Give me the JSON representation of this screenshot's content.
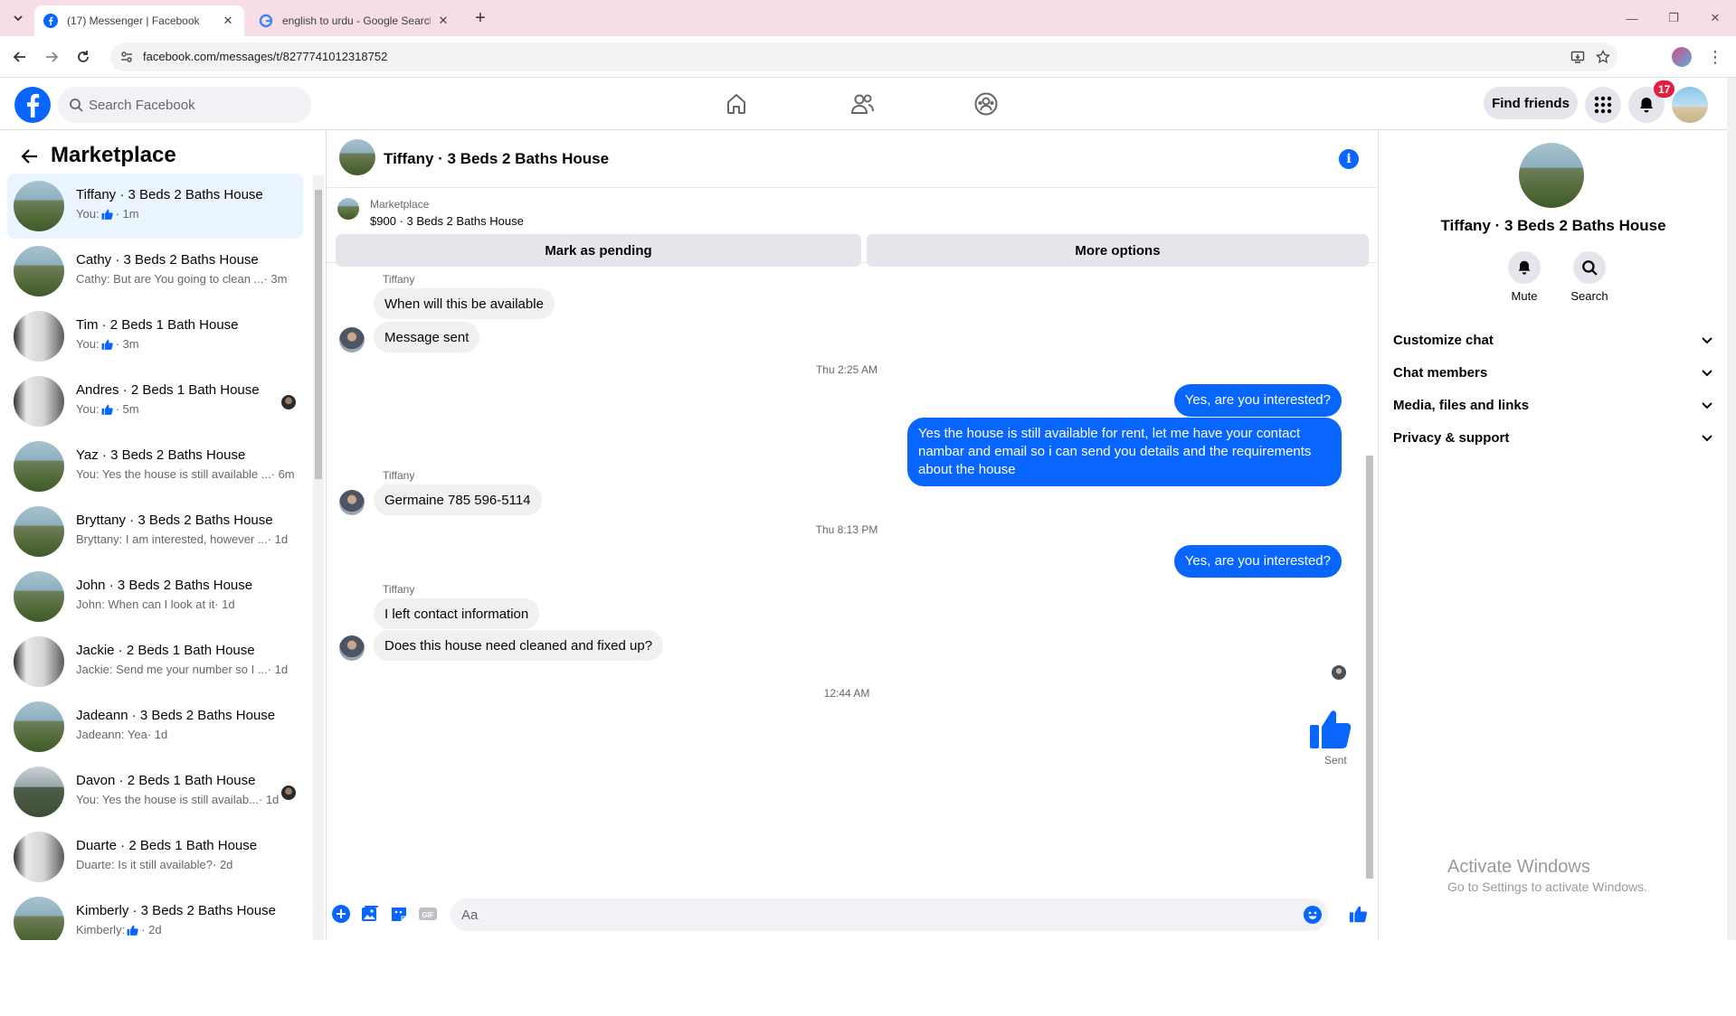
{
  "browser": {
    "tabs": [
      {
        "title": "(17) Messenger | Facebook",
        "active": true
      },
      {
        "title": "english to urdu - Google Search",
        "active": false
      }
    ],
    "url": "facebook.com/messages/t/8277741012318752"
  },
  "header": {
    "search_placeholder": "Search Facebook",
    "find_friends_label": "Find friends",
    "notification_count": "17"
  },
  "sidebar": {
    "title": "Marketplace",
    "conversations": [
      {
        "name": "Tiffany · 3 Beds 2 Baths House",
        "preview": "You:",
        "preview_like": true,
        "time": "· 1m",
        "active": true
      },
      {
        "name": "Cathy · 3 Beds 2 Baths House",
        "preview": "Cathy: But are You going to clean ... ",
        "preview_like": false,
        "time": "· 3m"
      },
      {
        "name": "Tim · 2 Beds 1 Bath House",
        "preview": "You:",
        "preview_like": true,
        "time": "· 3m"
      },
      {
        "name": "Andres · 2 Beds 1 Bath House",
        "preview": "You:",
        "preview_like": true,
        "time": "· 5m",
        "seen": true
      },
      {
        "name": "Yaz · 3 Beds 2 Baths House",
        "preview": "You: Yes the house is still available ... ",
        "preview_like": false,
        "time": "· 6m"
      },
      {
        "name": "Bryttany · 3 Beds 2 Baths House",
        "preview": "Bryttany: I am interested, however ... ",
        "preview_like": false,
        "time": "· 1d"
      },
      {
        "name": "John · 3 Beds 2 Baths House",
        "preview": "John: When can I look at it ",
        "preview_like": false,
        "time": "· 1d"
      },
      {
        "name": "Jackie · 2 Beds 1 Bath House",
        "preview": "Jackie: Send me your number so I ... ",
        "preview_like": false,
        "time": "· 1d"
      },
      {
        "name": "Jadeann · 3 Beds 2 Baths House",
        "preview": "Jadeann: Yea ",
        "preview_like": false,
        "time": "· 1d"
      },
      {
        "name": "Davon · 2 Beds 1 Bath House",
        "preview": "You: Yes the house is still availab... ",
        "preview_like": false,
        "time": "· 1d",
        "seen": true
      },
      {
        "name": "Duarte · 2 Beds 1 Bath House",
        "preview": "Duarte: Is it still available? ",
        "preview_like": false,
        "time": "· 2d"
      },
      {
        "name": "Kimberly · 3 Beds 2 Baths House",
        "preview": "Kimberly:",
        "preview_like": true,
        "time": "· 2d"
      }
    ]
  },
  "chat": {
    "title": "Tiffany · 3 Beds 2 Baths House",
    "listing_label": "Marketplace",
    "listing_price": "$900 · 3 Beds 2 Baths House",
    "mark_pending_label": "Mark as pending",
    "more_options_label": "More options",
    "sender_name": "Tiffany",
    "messages": {
      "in1": "When will this be available",
      "in2": "Message sent",
      "ts1": "Thu 2:25 AM",
      "out1": "Yes, are you interested?",
      "out2": "Yes the house is still available for rent, let me have your contact nambar and email so i can send you details and the requirements about the house",
      "in3": "Germaine 785 596-5114",
      "ts2": "Thu 8:13 PM",
      "out3": "Yes, are you interested?",
      "in4": "I left contact information",
      "in5": "Does this house need cleaned and fixed up?",
      "ts3": "12:44 AM",
      "sent_label": "Sent"
    },
    "composer_placeholder": "Aa"
  },
  "details": {
    "name": "Tiffany · 3 Beds 2 Baths House",
    "mute_label": "Mute",
    "search_label": "Search",
    "sections": [
      "Customize chat",
      "Chat members",
      "Media, files and links",
      "Privacy & support"
    ]
  },
  "watermark": {
    "line1": "Activate Windows",
    "line2": "Go to Settings to activate Windows."
  },
  "colors": {
    "brand": "#0866ff",
    "tabbar": "#f7dde6",
    "badge": "#e41e3f"
  }
}
